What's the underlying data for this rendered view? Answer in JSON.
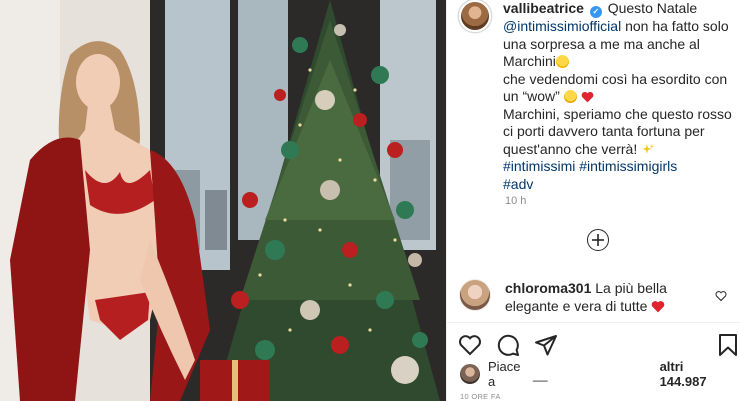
{
  "post": {
    "username": "vallibeatrice",
    "verified": true,
    "caption": {
      "line1_after_user": "Questo Natale",
      "mention": "@intimissimiofficial",
      "line2_after_mention": " non ha fatto solo",
      "line3": "una sorpresa a me ma anche al",
      "line4": "Marchini",
      "line5": "che vedendomi così ha esordito con",
      "line6": "un “wow”",
      "line7": "Marchini, speriamo che questo rosso",
      "line8": "ci porti davvero tanta fortuna per",
      "line9": "quest'anno che verrà!",
      "hashtags_line1": "#intimissimi #intimissimigirls",
      "hashtags_line2": "#adv"
    },
    "timestamp": "10 h",
    "load_more_icon": "plus-circle-icon"
  },
  "comment": {
    "username": "chloroma301",
    "text_line1": "La più bella",
    "text_line2": "elegante e vera di tutte"
  },
  "actions": {
    "like_icon": "heart-outline-icon",
    "comment_icon": "comment-icon",
    "share_icon": "share-icon",
    "save_icon": "bookmark-icon"
  },
  "likes": {
    "prefix": "Piace a",
    "hidden_name": "__",
    "and_others": "altri 144.987"
  },
  "date_label": "10 ORE FA",
  "colors": {
    "link": "#00376b",
    "verified": "#3897f0",
    "heart_red": "#ed4956",
    "muted": "#8e8e8e"
  }
}
